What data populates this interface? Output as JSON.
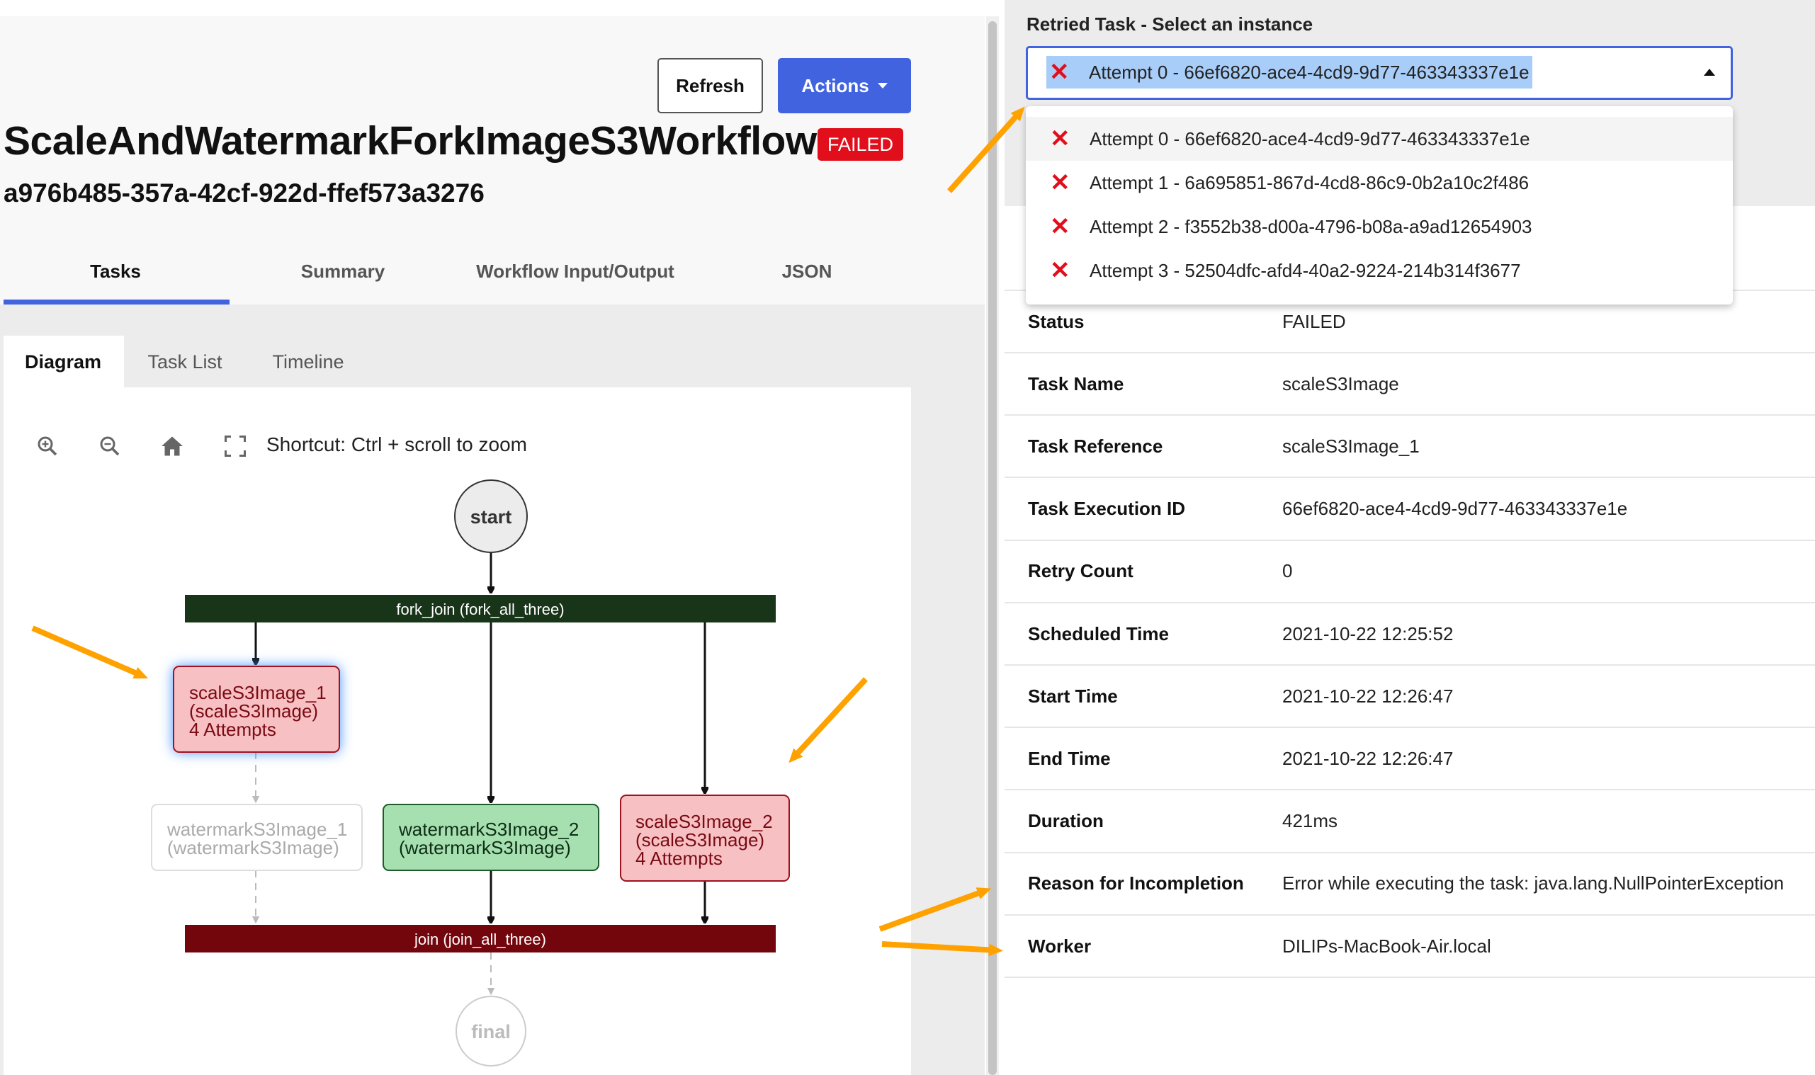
{
  "header": {
    "refresh_label": "Refresh",
    "actions_label": "Actions",
    "workflow_name": "ScaleAndWatermarkForkImageS3Workflow",
    "status_badge": "FAILED",
    "workflow_id": "a976b485-357a-42cf-922d-ffef573a3276"
  },
  "tabs": [
    {
      "label": "Tasks",
      "active": true
    },
    {
      "label": "Summary"
    },
    {
      "label": "Workflow Input/Output"
    },
    {
      "label": "JSON"
    }
  ],
  "subtabs": [
    {
      "label": "Diagram",
      "active": true
    },
    {
      "label": "Task List"
    },
    {
      "label": "Timeline"
    }
  ],
  "toolbar": {
    "icons": [
      "zoom-in-icon",
      "zoom-out-icon",
      "home-icon",
      "fullscreen-icon"
    ],
    "shortcut": "Shortcut: Ctrl + scroll to zoom"
  },
  "diagram": {
    "start": "start",
    "fork": "fork_join (fork_all_three)",
    "join": "join (join_all_three)",
    "final": "final",
    "nodes": [
      {
        "lines": [
          "scaleS3Image_1",
          "(scaleS3Image)",
          "4 Attempts"
        ],
        "status": "failed",
        "selected": true
      },
      {
        "lines": [
          "watermarkS3Image_1",
          "(watermarkS3Image)"
        ],
        "status": "not-executed"
      },
      {
        "lines": [
          "watermarkS3Image_2",
          "(watermarkS3Image)"
        ],
        "status": "completed"
      },
      {
        "lines": [
          "scaleS3Image_2",
          "(scaleS3Image)",
          "4 Attempts"
        ],
        "status": "failed"
      }
    ]
  },
  "colors": {
    "accent": "#4263e0",
    "failed": "#e10e1b",
    "fork_bar": "#183519",
    "join_bar": "#73060c",
    "failed_node": "#f7c0c3",
    "completed_node": "#a6dfb0",
    "annotation_arrow": "#ffa200"
  },
  "instance_select": {
    "label": "Retried Task - Select an instance",
    "selected": "Attempt 0 - 66ef6820-ace4-4cd9-9d77-463343337e1e",
    "options": [
      "Attempt 0 - 66ef6820-ace4-4cd9-9d77-463343337e1e",
      "Attempt 1 - 6a695851-867d-4cd8-86c9-0b2a10c2f486",
      "Attempt 2 - f3552b38-d00a-4796-b08a-a9ad12654903",
      "Attempt 3 - 52504dfc-afd4-40a2-9224-214b314f3677"
    ]
  },
  "details": [
    {
      "key": "Status",
      "value": "FAILED"
    },
    {
      "key": "Task Name",
      "value": "scaleS3Image"
    },
    {
      "key": "Task Reference",
      "value": "scaleS3Image_1"
    },
    {
      "key": "Task Execution ID",
      "value": "66ef6820-ace4-4cd9-9d77-463343337e1e"
    },
    {
      "key": "Retry Count",
      "value": "0"
    },
    {
      "key": "Scheduled Time",
      "value": "2021-10-22 12:25:52"
    },
    {
      "key": "Start Time",
      "value": "2021-10-22 12:26:47"
    },
    {
      "key": "End Time",
      "value": "2021-10-22 12:26:47"
    },
    {
      "key": "Duration",
      "value": "421ms"
    },
    {
      "key": "Reason for Incompletion",
      "value": "Error while executing the task: java.lang.NullPointerException"
    },
    {
      "key": "Worker",
      "value": "DILIPs-MacBook-Air.local"
    }
  ]
}
